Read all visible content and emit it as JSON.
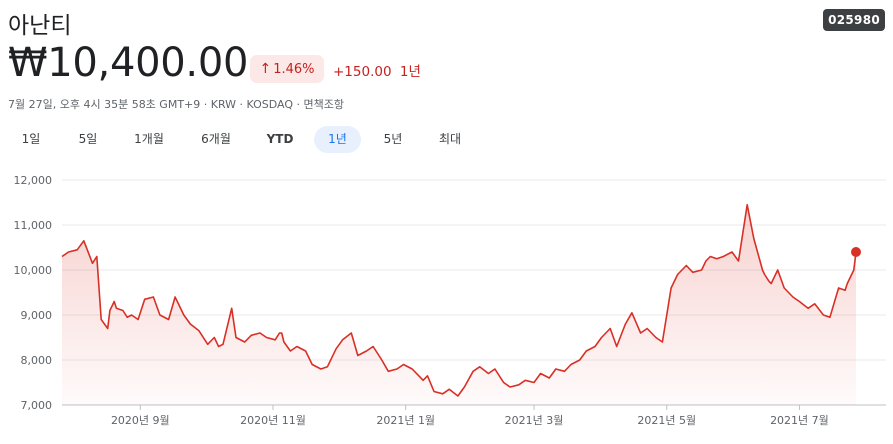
{
  "header": {
    "name": "아난티",
    "ticker": "025980",
    "price": "₩10,400.00",
    "change_percent": "1.46%",
    "change_arrow": "↑",
    "change_abs": "+150.00",
    "change_period": "1년",
    "meta": "7월 27일, 오후 4시 35분 58초 GMT+9 · KRW · KOSDAQ · 면책조항"
  },
  "tabs": [
    {
      "label": "1일"
    },
    {
      "label": "5일"
    },
    {
      "label": "1개월"
    },
    {
      "label": "6개월"
    },
    {
      "label": "YTD"
    },
    {
      "label": "1년",
      "active": true
    },
    {
      "label": "5년"
    },
    {
      "label": "최대"
    }
  ],
  "colors": {
    "line": "#d93025",
    "accent_active_tab": "#1a73e8",
    "negative_text": "#c5221f"
  },
  "chart_data": {
    "type": "area",
    "ylim": [
      7000,
      12000
    ],
    "yticks": [
      "12,000",
      "11,000",
      "10,000",
      "9,000",
      "8,000",
      "7,000"
    ],
    "xticks": [
      "2020년 9월",
      "2020년 11월",
      "2021년 1월",
      "2021년 3월",
      "2021년 5월",
      "2021년 7월"
    ],
    "x_start": "2020-07-27",
    "x_end": "2021-07-27",
    "grid": true,
    "series": [
      {
        "x": [
          "2020-07-27",
          "2020-07-30",
          "2020-08-03",
          "2020-08-06",
          "2020-08-10",
          "2020-08-12",
          "2020-08-14",
          "2020-08-17",
          "2020-08-18",
          "2020-08-20",
          "2020-08-21",
          "2020-08-24",
          "2020-08-26",
          "2020-08-28",
          "2020-08-31",
          "2020-09-03",
          "2020-09-07",
          "2020-09-10",
          "2020-09-14",
          "2020-09-17",
          "2020-09-21",
          "2020-09-24",
          "2020-09-28",
          "2020-10-02",
          "2020-10-05",
          "2020-10-07",
          "2020-10-09",
          "2020-10-13",
          "2020-10-15",
          "2020-10-19",
          "2020-10-22",
          "2020-10-26",
          "2020-10-29",
          "2020-11-02",
          "2020-11-04",
          "2020-11-05",
          "2020-11-06",
          "2020-11-09",
          "2020-11-12",
          "2020-11-16",
          "2020-11-19",
          "2020-11-23",
          "2020-11-26",
          "2020-11-30",
          "2020-12-03",
          "2020-12-07",
          "2020-12-10",
          "2020-12-14",
          "2020-12-17",
          "2020-12-21",
          "2020-12-24",
          "2020-12-28",
          "2020-12-31",
          "2021-01-04",
          "2021-01-07",
          "2021-01-09",
          "2021-01-11",
          "2021-01-14",
          "2021-01-18",
          "2021-01-21",
          "2021-01-25",
          "2021-01-28",
          "2021-02-01",
          "2021-02-04",
          "2021-02-08",
          "2021-02-11",
          "2021-02-15",
          "2021-02-18",
          "2021-02-22",
          "2021-02-25",
          "2021-03-01",
          "2021-03-04",
          "2021-03-08",
          "2021-03-11",
          "2021-03-15",
          "2021-03-18",
          "2021-03-22",
          "2021-03-25",
          "2021-03-29",
          "2021-04-01",
          "2021-04-05",
          "2021-04-08",
          "2021-04-12",
          "2021-04-15",
          "2021-04-19",
          "2021-04-22",
          "2021-04-26",
          "2021-04-29",
          "2021-05-03",
          "2021-05-06",
          "2021-05-10",
          "2021-05-13",
          "2021-05-17",
          "2021-05-19",
          "2021-05-21",
          "2021-05-24",
          "2021-05-27",
          "2021-05-31",
          "2021-06-03",
          "2021-06-07",
          "2021-06-10",
          "2021-06-14",
          "2021-06-15",
          "2021-06-17",
          "2021-06-18",
          "2021-06-21",
          "2021-06-24",
          "2021-06-28",
          "2021-07-01",
          "2021-07-05",
          "2021-07-08",
          "2021-07-12",
          "2021-07-15",
          "2021-07-19",
          "2021-07-22",
          "2021-07-23",
          "2021-07-26",
          "2021-07-27"
        ],
        "y": [
          10300,
          10400,
          10450,
          10650,
          10150,
          10300,
          8900,
          8700,
          9100,
          9300,
          9150,
          9100,
          8950,
          9000,
          8900,
          9350,
          9400,
          9000,
          8900,
          9400,
          9000,
          8800,
          8650,
          8350,
          8500,
          8300,
          8350,
          9150,
          8500,
          8400,
          8550,
          8600,
          8500,
          8450,
          8600,
          8600,
          8400,
          8200,
          8300,
          8200,
          7900,
          7800,
          7850,
          8250,
          8450,
          8600,
          8100,
          8200,
          8300,
          8000,
          7750,
          7800,
          7900,
          7800,
          7650,
          7550,
          7650,
          7300,
          7250,
          7350,
          7200,
          7400,
          7750,
          7850,
          7700,
          7800,
          7500,
          7400,
          7450,
          7550,
          7500,
          7700,
          7600,
          7800,
          7750,
          7900,
          8000,
          8200,
          8300,
          8500,
          8700,
          8300,
          8800,
          9050,
          8600,
          8700,
          8500,
          8400,
          9600,
          9900,
          10100,
          9950,
          10000,
          10200,
          10300,
          10250,
          10300,
          10400,
          10200,
          11450,
          10700,
          10000,
          9900,
          9750,
          9700,
          10000,
          9600,
          9400,
          9300,
          9150,
          9250,
          9000,
          8950,
          9600,
          9550,
          9700,
          10000,
          10400
        ]
      }
    ]
  }
}
